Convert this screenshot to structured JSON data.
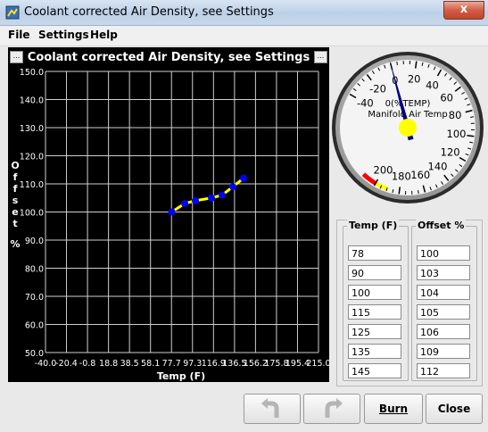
{
  "window": {
    "title": "Coolant corrected Air Density, see Settings",
    "close_glyph": "x"
  },
  "menu": {
    "file": "File",
    "settings": "Settings",
    "help": "Help"
  },
  "chart_panel": {
    "left_button": "...",
    "right_button": "..."
  },
  "chart_data": {
    "type": "line",
    "title": "Coolant corrected Air Density, see Settings",
    "xlabel": "Temp (F)",
    "ylabel": "Offset %",
    "xlim": [
      -40.0,
      215.0
    ],
    "ylim": [
      50.0,
      150.0
    ],
    "yticks": [
      "150.0",
      "140.0",
      "130.0",
      "120.0",
      "110.0",
      "100.0",
      "90.0",
      "80.0",
      "70.0",
      "60.0",
      "50.0"
    ],
    "xticks": [
      "-40.0",
      "-20.4",
      "-0.8",
      "18.8",
      "38.5",
      "58.1",
      "77.7",
      "97.3",
      "116.9",
      "136.5",
      "156.2",
      "175.8",
      "195.4",
      "215.0"
    ],
    "x": [
      78,
      90,
      100,
      115,
      125,
      135,
      145
    ],
    "values": [
      100,
      103,
      104,
      105,
      106,
      109,
      112
    ],
    "line_color": "#ffff00",
    "point_color": "#0000ff",
    "grid": true
  },
  "gauge": {
    "label_value": "0(%TEMP)",
    "label_name": "Manifold Air Temp",
    "ticks": [
      "-40",
      "-20",
      "0",
      "20",
      "40",
      "60",
      "80",
      "100",
      "120",
      "140",
      "160",
      "180",
      "200"
    ],
    "min": -40,
    "max": 200,
    "value": 0,
    "needle_color": "#000080",
    "hub_color": "#ffff00",
    "warning_color": "#ffff00",
    "danger_color": "#ff0000"
  },
  "table": {
    "col1_header": "Temp (F)",
    "col2_header": "Offset %",
    "temps": [
      "78",
      "90",
      "100",
      "115",
      "125",
      "135",
      "145"
    ],
    "offsets": [
      "100",
      "103",
      "104",
      "105",
      "106",
      "109",
      "112"
    ]
  },
  "buttons": {
    "undo": "undo-icon",
    "redo": "redo-icon",
    "burn": "Burn",
    "close": "Close"
  }
}
